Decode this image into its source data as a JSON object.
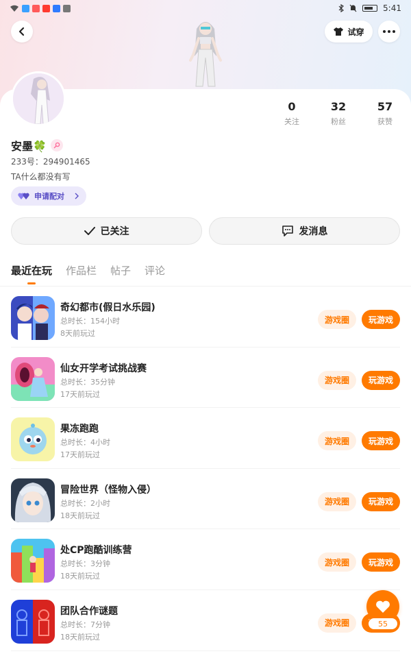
{
  "status_bar": {
    "time": "5:41"
  },
  "header": {
    "try_on_label": "试穿"
  },
  "profile": {
    "name": "安墨🍀",
    "id_line": "233号：294901465",
    "bio": "TA什么都没有写",
    "pair_label": "申请配对",
    "stats": [
      {
        "value": "0",
        "label": "关注"
      },
      {
        "value": "32",
        "label": "粉丝"
      },
      {
        "value": "57",
        "label": "获赞"
      }
    ],
    "follow_label": "已关注",
    "message_label": "发消息"
  },
  "tabs": [
    "最近在玩",
    "作品栏",
    "帖子",
    "评论"
  ],
  "games": [
    {
      "title": "奇幻都市(假日水乐园)",
      "duration": "总时长：154小时",
      "last_played": "8天前玩过"
    },
    {
      "title": "仙女开学考试挑战赛",
      "duration": "总时长：35分钟",
      "last_played": "17天前玩过"
    },
    {
      "title": "果冻跑跑",
      "duration": "总时长：4小时",
      "last_played": "17天前玩过"
    },
    {
      "title": "冒险世界（怪物入侵）",
      "duration": "总时长：2小时",
      "last_played": "18天前玩过"
    },
    {
      "title": "处CP跑酷训练营",
      "duration": "总时长：3分钟",
      "last_played": "18天前玩过"
    },
    {
      "title": "团队合作谜题",
      "duration": "总时长：7分钟",
      "last_played": "18天前玩过"
    }
  ],
  "buttons": {
    "circle": "游戏圈",
    "play": "玩游戏"
  },
  "fab": {
    "count": "55"
  },
  "colors": {
    "accent": "#ff7a00",
    "accent_light": "#fff0e4",
    "pair_purple": "#5a4fc6"
  }
}
